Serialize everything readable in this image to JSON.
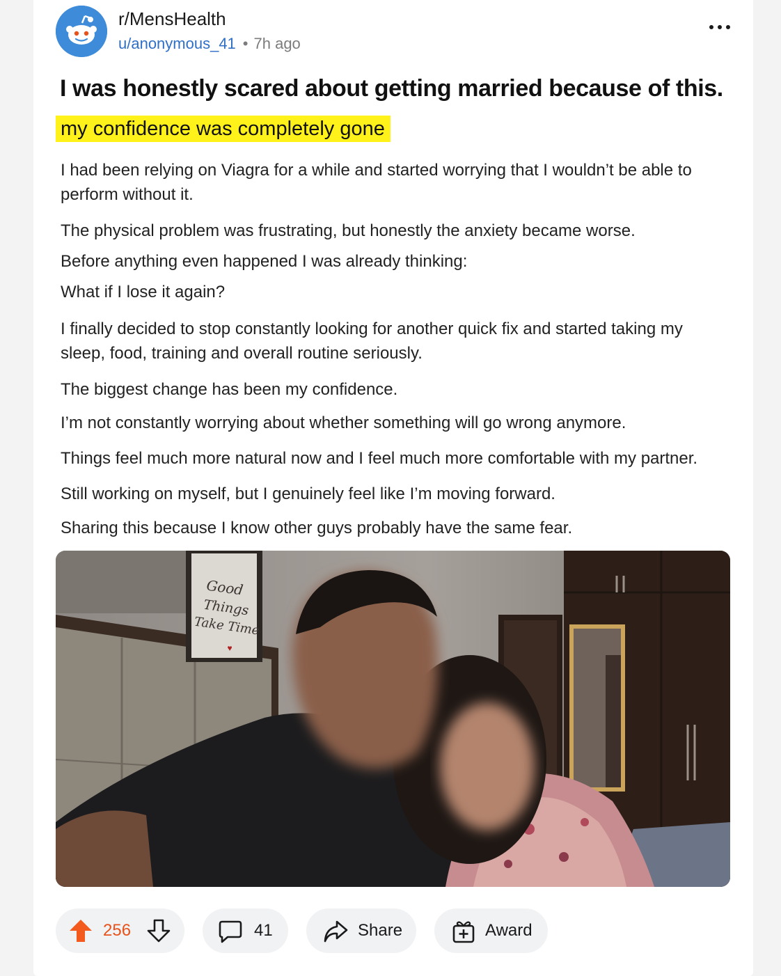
{
  "post": {
    "subreddit": "r/MensHealth",
    "username": "u/anonymous_41",
    "separator": "•",
    "time": "7h ago",
    "title": "I was honestly scared about getting married because of this.",
    "highlight": "my confidence was completely gone",
    "paragraphs": [
      "I had been relying on Viagra for a while and started worrying that I wouldn’t be able to perform without it.",
      "The physical problem was frustrating, but honestly the anxiety became worse.",
      "Before anything even happened I was already thinking:",
      "What if I lose it again?",
      "I finally decided to stop constantly looking for another quick fix and started taking my sleep, food, training and overall routine seriously.",
      "The biggest change has been my confidence.",
      "I’m not constantly worrying about whether something will go wrong anymore.",
      "Things feel much more natural now and I feel much more comfortable with my partner.",
      "Still working on myself, but I genuinely feel like I’m moving forward.",
      "Sharing this because I know other guys probably have the same fear."
    ],
    "photo": {
      "sign_lines": [
        "Good",
        "Things",
        "Take Time"
      ]
    }
  },
  "actions": {
    "upvotes": "256",
    "comments": "41",
    "share_label": "Share",
    "award_label": "Award"
  },
  "colors": {
    "upvote": "#f35a1e",
    "highlight": "#fff21a",
    "username": "#2f6fc6",
    "avatar": "#3d8bd9"
  },
  "icons": [
    "reddit-snoo-icon",
    "more-options-icon",
    "upvote-arrow-icon",
    "downvote-arrow-icon",
    "comment-bubble-icon",
    "share-arrow-icon",
    "award-gift-icon"
  ]
}
